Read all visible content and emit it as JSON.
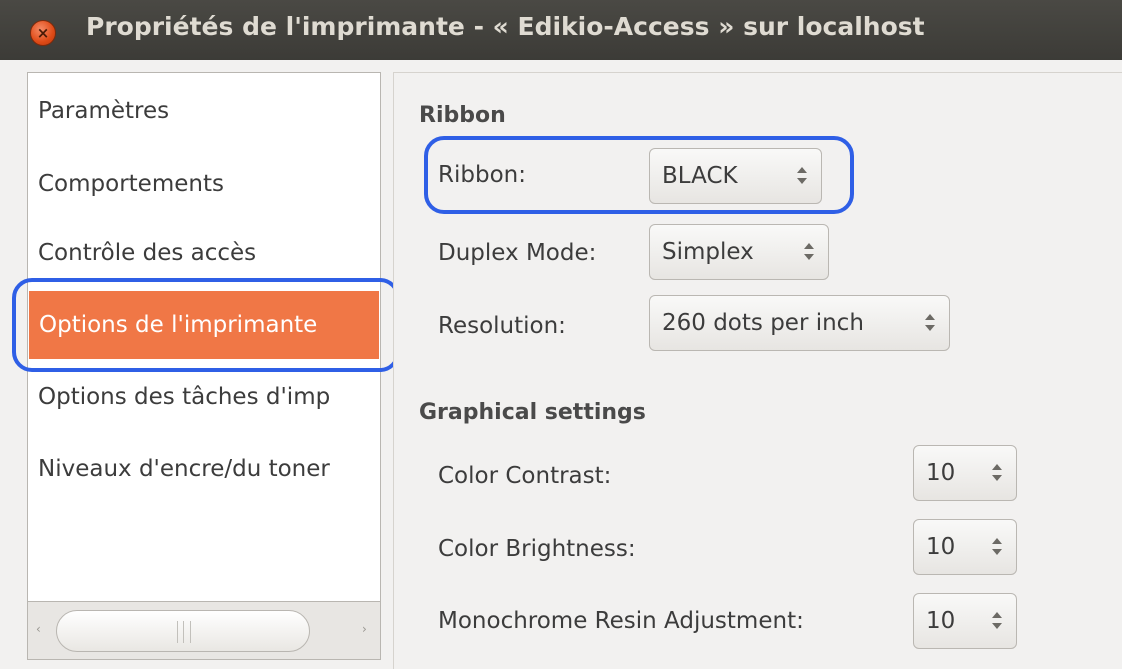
{
  "window": {
    "title": "Propriétés de l'imprimante - « Edikio-Access » sur localhost",
    "close_glyph": "×"
  },
  "sidebar": {
    "items": [
      {
        "label": "Paramètres"
      },
      {
        "label": "Comportements"
      },
      {
        "label": "Contrôle des accès"
      },
      {
        "label": "Options de l'imprimante",
        "selected": true
      },
      {
        "label": "Options des tâches d'imp"
      },
      {
        "label": "Niveaux d'encre/du toner"
      }
    ],
    "scroll_left_glyph": "‹",
    "scroll_right_glyph": "›"
  },
  "ribbon_section": {
    "title": "Ribbon",
    "fields": [
      {
        "label": "Ribbon:",
        "value": "BLACK"
      },
      {
        "label": "Duplex Mode:",
        "value": "Simplex"
      },
      {
        "label": "Resolution:",
        "value": "260 dots per inch"
      }
    ]
  },
  "graphical_section": {
    "title": "Graphical settings",
    "fields": [
      {
        "label": "Color Contrast:",
        "value": "10"
      },
      {
        "label": "Color Brightness:",
        "value": "10"
      },
      {
        "label": "Monochrome Resin Adjustment:",
        "value": "10"
      }
    ]
  },
  "colors": {
    "selection": "#f07746",
    "highlight_annotation": "#2f5fe6",
    "titlebar": "#3c3b37"
  }
}
